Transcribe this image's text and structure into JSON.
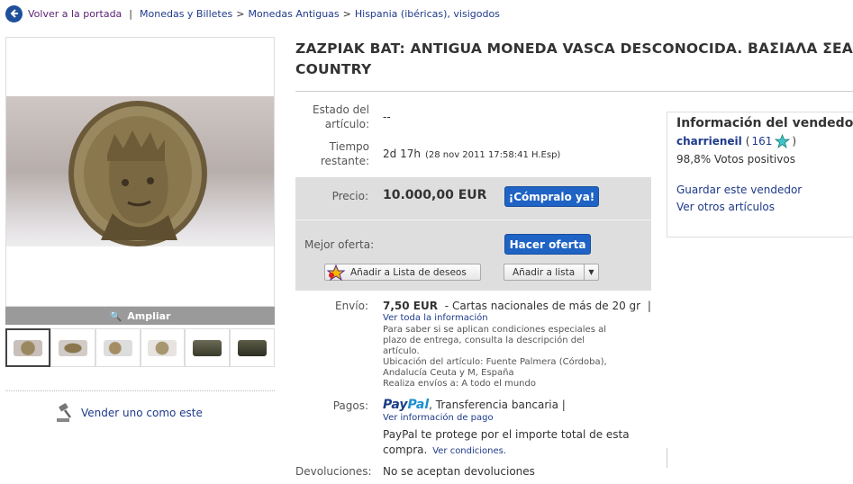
{
  "breadcrumb": {
    "back_label": "Volver a la portada",
    "items": [
      "Monedas y Billetes",
      "Monedas Antiguas",
      "Hispania (ibéricas), visigodos"
    ],
    "separator": ">"
  },
  "gallery": {
    "zoom_label": "Ampliar",
    "thumbnail_count": 6,
    "selected_thumbnail": 1
  },
  "sell_similar": {
    "label": "Vender uno como este"
  },
  "listing": {
    "title_line1": "ZAZPIAK BAT: ANTIGUA MONEDA VASCA DESCONOCIDA. ΒΑΣΙΑΛΑ ΣΕΑΒΥΡΟΥ",
    "title_line2": "COUNTRY",
    "condition_label_1": "Estado del",
    "condition_label_2": "artículo:",
    "condition_value": "--",
    "time_label_1": "Tiempo",
    "time_label_2": "restante:",
    "time_value": "2d 17h",
    "time_detail": "(28 nov 2011 17:58:41 H.Esp)"
  },
  "price_box": {
    "price_label": "Precio:",
    "price_value": "10.000,00 EUR",
    "buy_button": "¡Cómpralo ya!",
    "offer_label": "Mejor oferta:",
    "offer_button": "Hacer oferta",
    "wishlist_button": "Añadir a Lista de deseos",
    "add_list_button": "Añadir a lista"
  },
  "shipping": {
    "label": "Envío:",
    "cost": "7,50 EUR",
    "method": "- Cartas nacionales de más de 20 gr",
    "pipe": "|",
    "info_link": "Ver toda la información",
    "note_1": "Para saber si se aplican condiciones especiales al",
    "note_2": "plazo de entrega, consulta la descripción del",
    "note_3": "artículo.",
    "location_1": "Ubicación del artículo: Fuente Palmera (Córdoba),",
    "location_2": "Andalucía Ceuta y M, España",
    "ships_to": "Realiza envíos a: A todo el mundo"
  },
  "payments": {
    "label": "Pagos:",
    "paypal_a": "Pay",
    "paypal_b": "Pal",
    "methods": ", Transferencia bancaria |",
    "info_link": "Ver información de pago",
    "protect_1": "PayPal te protege por el importe total de esta",
    "protect_2": "compra.",
    "conditions_link": "Ver condiciones."
  },
  "returns": {
    "label": "Devoluciones:",
    "value": "No se aceptan devoluciones"
  },
  "seller": {
    "heading": "Información del vendedor",
    "name": "charrieneil",
    "open_paren": "(",
    "score": "161",
    "close_paren": ")",
    "feedback": "98,8% Votos positivos",
    "save_link": "Guardar este vendedor",
    "other_items_link": "Ver otros artículos"
  },
  "colors": {
    "link": "#1e3a8a",
    "button_blue": "#1f63c4",
    "price_box": "#dedede",
    "star": "#3cc8c8"
  }
}
